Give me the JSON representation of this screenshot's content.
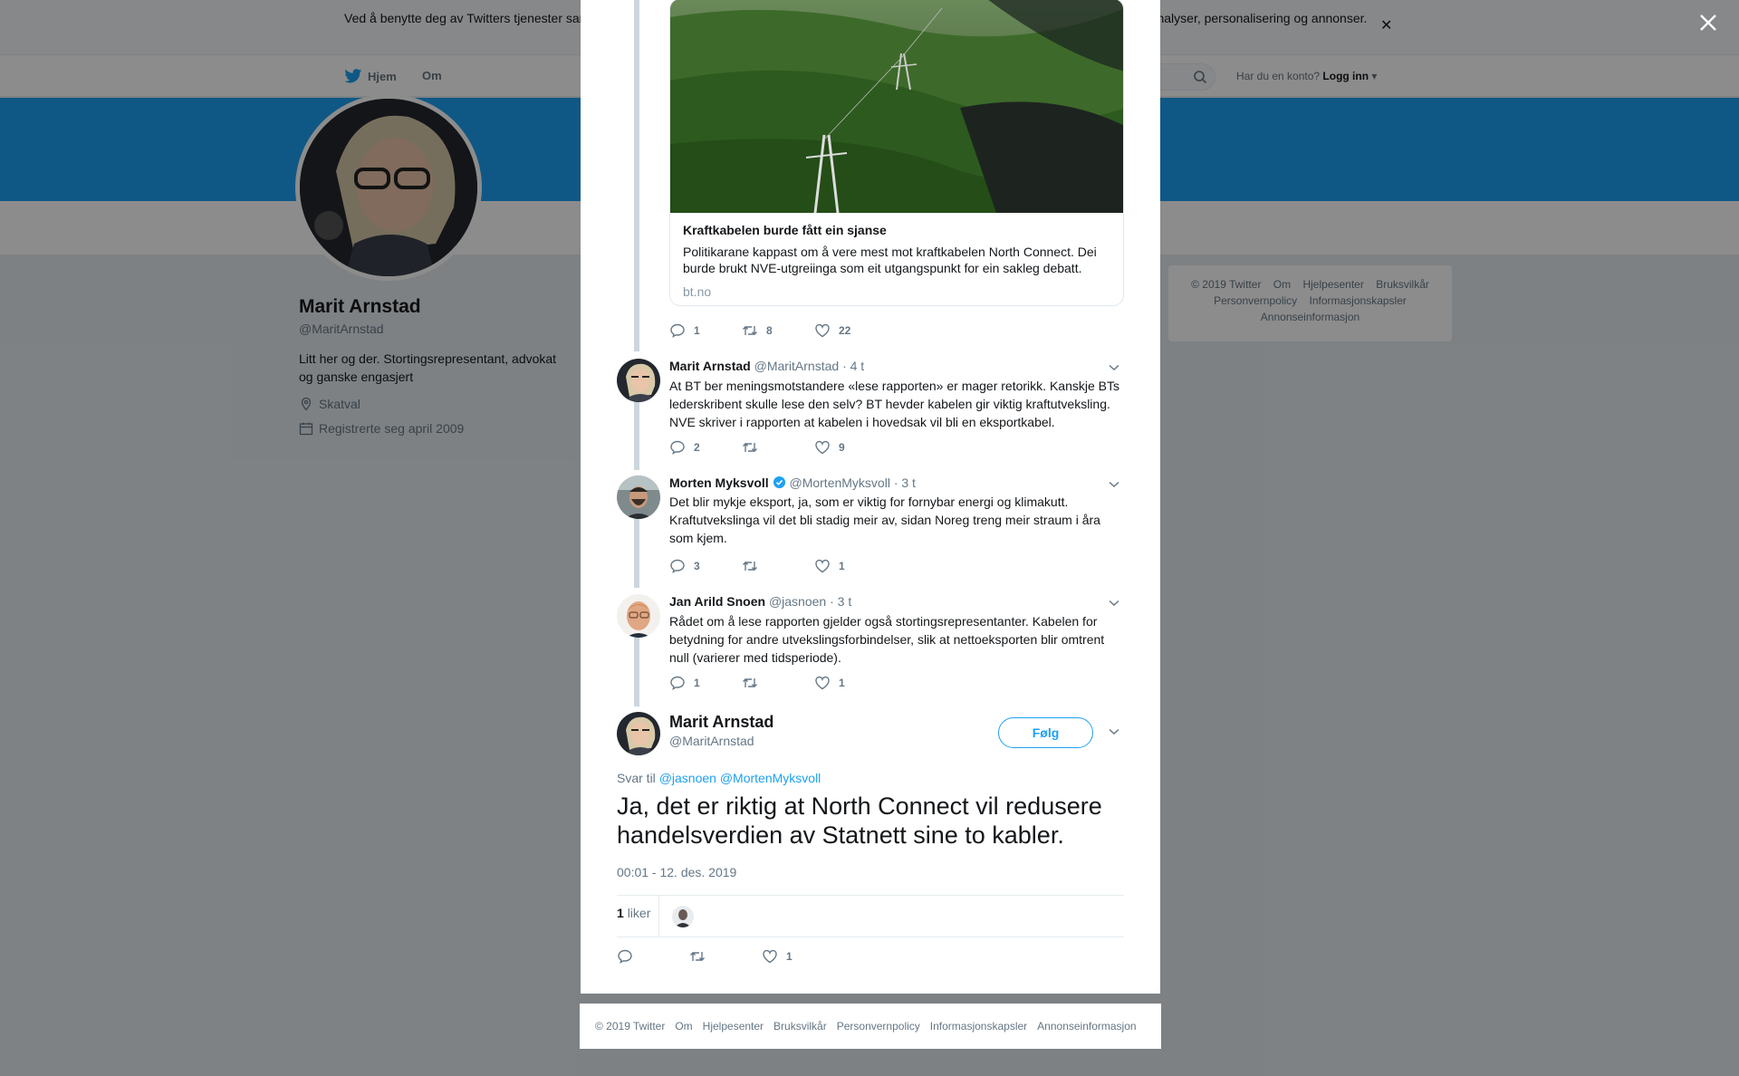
{
  "background": {
    "cookie_notice": "Ved å benytte deg av Twitters tjenester samtykker du til vår bruk av informasjonskapsler. Vi og våre partnere bruker informasjonskapsler til bl.a. analyser, personalisering og annonser.",
    "nav": {
      "home": "Hjem",
      "about": "Om"
    },
    "login": {
      "prompt": "Har du en konto?",
      "link": "Logg inn"
    },
    "profile": {
      "name": "Marit Arnstad",
      "handle": "@MaritArnstad",
      "bio": "Litt her og der. Stortingsrepresentant, advokat og ganske engasjert",
      "location": "Skatval",
      "joined": "Registrerte seg april 2009"
    },
    "sidebar_footer": [
      "© 2019 Twitter",
      "Om",
      "Hjelpesenter",
      "Bruksvilkår",
      "Personvernpolicy",
      "Informasjonskapsler",
      "Annonseinformasjon"
    ]
  },
  "card": {
    "title": "Kraftkabelen burde fått ein sjanse",
    "description": "Politikarane kappast om å vere mest mot kraftkabelen North Connect. Dei burde brukt NVE-utgreiinga som eit utgangspunkt for ein sakleg debatt.",
    "domain": "bt.no"
  },
  "parent_actions": {
    "replies": "1",
    "retweets": "8",
    "likes": "22"
  },
  "replies": [
    {
      "name": "Marit Arnstad",
      "handle": "@MaritArnstad",
      "time": "· 4 t",
      "verified": false,
      "text": "At BT ber meningsmotstandere «lese rapporten» er mager retorikk. Kanskje BTs lederskribent skulle lese den selv? BT hevder kabelen gir viktig kraftutveksling. NVE skriver i rapporten at kabelen i hovedsak vil bli en eksportkabel.",
      "replies": "2",
      "retweets": "",
      "likes": "9"
    },
    {
      "name": "Morten Myksvoll",
      "handle": "@MortenMyksvoll",
      "time": "· 3 t",
      "verified": true,
      "text": "Det blir mykje eksport, ja, som er viktig for fornybar energi og klimakutt. Kraftutvekslinga vil det bli stadig meir av, sidan Noreg treng meir straum i åra som kjem.",
      "replies": "3",
      "retweets": "",
      "likes": "1"
    },
    {
      "name": "Jan Arild Snoen",
      "handle": "@jasnoen",
      "time": "· 3 t",
      "verified": false,
      "text": "Rådet om å lese rapporten gjelder også stortingsrepresentanter. Kabelen for betydning for andre utvekslingsforbindelser, slik at nettoeksporten blir omtrent null (varierer med tidsperiode).",
      "replies": "1",
      "retweets": "",
      "likes": "1"
    }
  ],
  "main_tweet": {
    "name": "Marit Arnstad",
    "handle": "@MaritArnstad",
    "follow_label": "Følg",
    "reply_to_label": "Svar til",
    "reply_to_users": "@jasnoen @MortenMyksvoll",
    "text": "Ja, det er riktig at North Connect vil redusere handelsverdien av Statnett sine to kabler.",
    "timestamp": "00:01 - 12. des. 2019",
    "like_count": "1",
    "like_label": "liker",
    "actions": {
      "replies": "",
      "retweets": "",
      "likes": "1"
    }
  },
  "bottom_footer": [
    "© 2019 Twitter",
    "Om",
    "Hjelpesenter",
    "Bruksvilkår",
    "Personvernpolicy",
    "Informasjonskapsler",
    "Annonseinformasjon"
  ],
  "colors": {
    "accent": "#1da1f2",
    "header": "#1da1f2",
    "text": "#14171a",
    "secondary": "#657786",
    "thread_line": "#ccd6dd"
  },
  "icons": [
    "twitter-bird-icon",
    "search-icon",
    "close-icon",
    "location-icon",
    "calendar-icon",
    "reply-icon",
    "retweet-icon",
    "heart-icon",
    "verified-icon",
    "chevron-down-icon"
  ]
}
